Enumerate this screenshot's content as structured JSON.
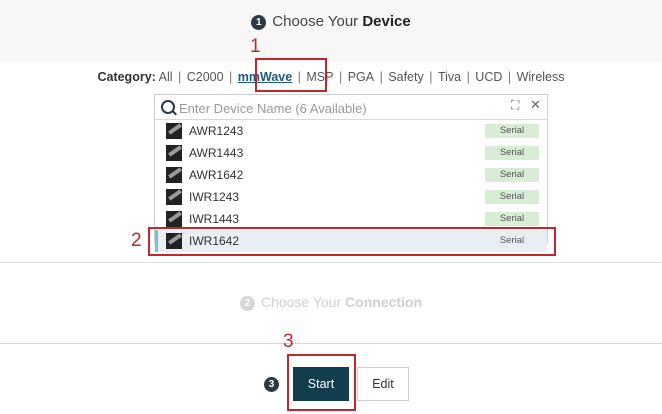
{
  "step1": {
    "number": "1",
    "title_prefix": "Choose Your ",
    "title_bold": "Device"
  },
  "category": {
    "label": "Category:",
    "items": [
      "All",
      "C2000",
      "mmWave",
      "MSP",
      "PGA",
      "Safety",
      "Tiva",
      "UCD",
      "Wireless"
    ],
    "active": "mmWave"
  },
  "search": {
    "placeholder": "Enter Device Name (6 Available)",
    "expand_glyph": "⛶",
    "close_glyph": "✕"
  },
  "devices": [
    {
      "name": "AWR1243",
      "badge": "Serial"
    },
    {
      "name": "AWR1443",
      "badge": "Serial"
    },
    {
      "name": "AWR1642",
      "badge": "Serial"
    },
    {
      "name": "IWR1243",
      "badge": "Serial"
    },
    {
      "name": "IWR1443",
      "badge": "Serial"
    },
    {
      "name": "IWR1642",
      "badge": "Serial"
    }
  ],
  "selected_device": "IWR1642",
  "step2": {
    "number": "2",
    "title_prefix": "Choose Your ",
    "title_bold": "Connection"
  },
  "step3": {
    "number": "3",
    "start_label": "Start",
    "edit_label": "Edit"
  },
  "annotations": [
    "1",
    "2",
    "3"
  ],
  "colors": {
    "annotation": "#c1272d",
    "primary_button": "#123d4c",
    "badge_bg": "#d9ecd6",
    "selected_accent": "#6ec3d8"
  }
}
